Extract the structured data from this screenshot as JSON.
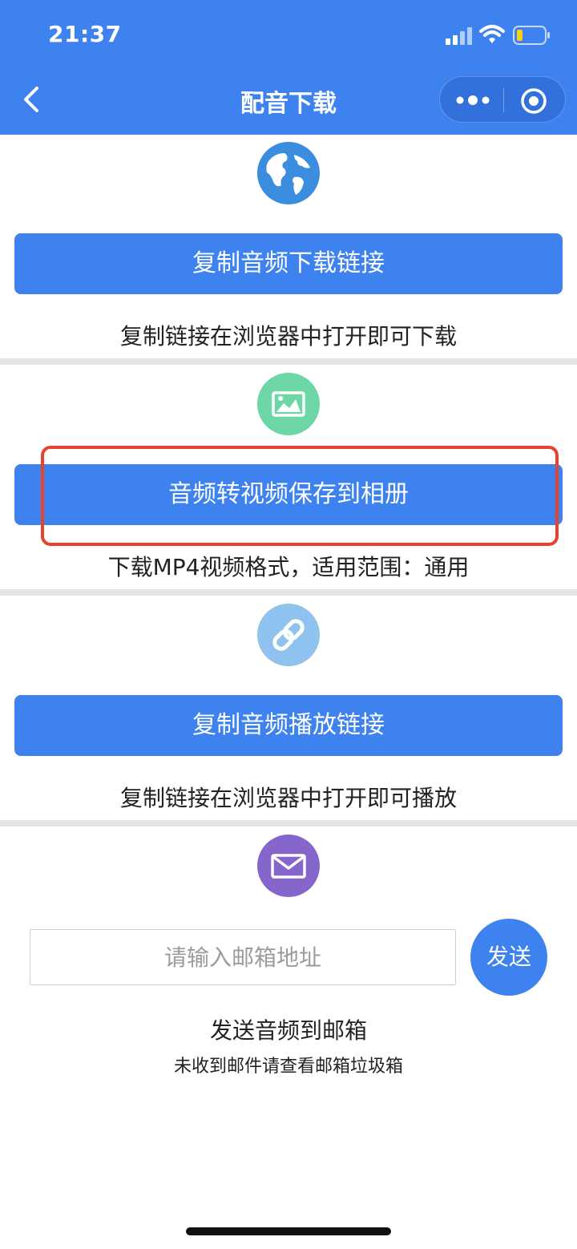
{
  "status_bar": {
    "time": "21:37"
  },
  "nav": {
    "title": "配音下载"
  },
  "sections": [
    {
      "button_label": "复制音频下载链接",
      "caption": "复制链接在浏览器中打开即可下载",
      "icon": "globe-icon",
      "color": "#3b8de0"
    },
    {
      "button_label": "音频转视频保存到相册",
      "caption": "下载MP4视频格式，适用范围：通用",
      "icon": "image-icon",
      "color": "#6cd6a4"
    },
    {
      "button_label": "复制音频播放链接",
      "caption": "复制链接在浏览器中打开即可播放",
      "icon": "link-icon",
      "color": "#8fc2ee"
    }
  ],
  "email": {
    "placeholder": "请输入邮箱地址",
    "send_label": "发送",
    "caption": "发送音频到邮箱",
    "hint": "未收到邮件请查看邮箱垃圾箱",
    "icon": "mail-icon",
    "color": "#8766cc"
  },
  "colors": {
    "primary": "#3e82f0",
    "highlight": "#e4432e"
  }
}
